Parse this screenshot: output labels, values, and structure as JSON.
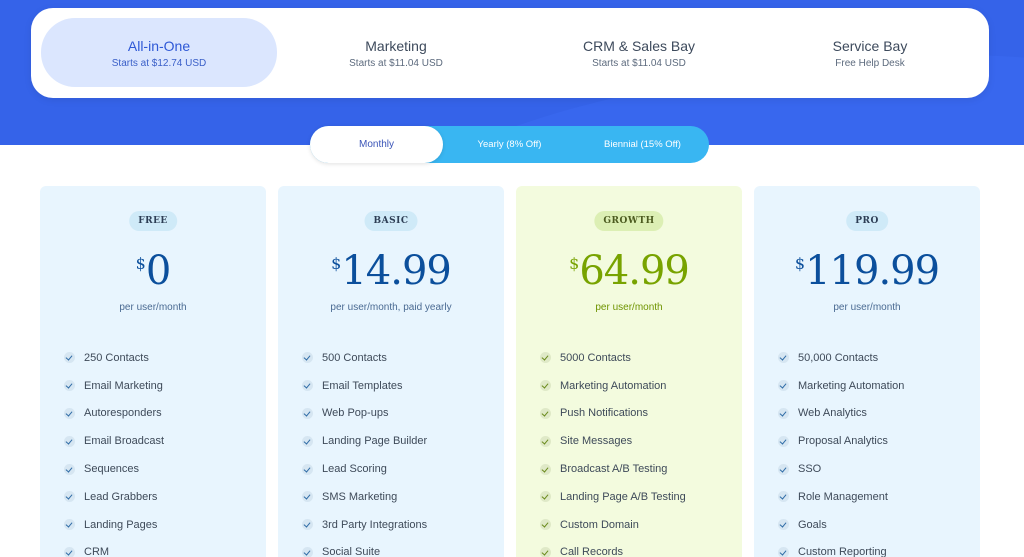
{
  "products": [
    {
      "name": "All-in-One",
      "sub": "Starts at $12.74 USD"
    },
    {
      "name": "Marketing",
      "sub": "Starts at $11.04 USD"
    },
    {
      "name": "CRM & Sales Bay",
      "sub": "Starts at $11.04 USD"
    },
    {
      "name": "Service Bay",
      "sub": "Free Help Desk"
    }
  ],
  "billing": {
    "monthly": "Monthly",
    "yearly": "Yearly (8% Off)",
    "biennial": "Biennial (15% Off)"
  },
  "plans": [
    {
      "badge": "FREE",
      "currency": "$",
      "price": "0",
      "period": "per user/month",
      "features": [
        "250 Contacts",
        "Email Marketing",
        "Autoresponders",
        "Email Broadcast",
        "Sequences",
        "Lead Grabbers",
        "Landing Pages",
        "CRM"
      ]
    },
    {
      "badge": "BASIC",
      "currency": "$",
      "price": "14.99",
      "period": "per user/month, paid yearly",
      "features": [
        "500 Contacts",
        "Email Templates",
        "Web Pop-ups",
        "Landing Page Builder",
        "Lead Scoring",
        "SMS Marketing",
        "3rd Party Integrations",
        "Social Suite"
      ]
    },
    {
      "badge": "GROWTH",
      "currency": "$",
      "price": "64.99",
      "period": "per user/month",
      "features": [
        "5000 Contacts",
        "Marketing Automation",
        "Push Notifications",
        "Site Messages",
        "Broadcast A/B Testing",
        "Landing Page A/B Testing",
        "Custom Domain",
        "Call Records"
      ]
    },
    {
      "badge": "PRO",
      "currency": "$",
      "price": "119.99",
      "period": "per user/month",
      "features": [
        "50,000 Contacts",
        "Marketing Automation",
        "Web Analytics",
        "Proposal Analytics",
        "SSO",
        "Role Management",
        "Goals",
        "Custom Reporting"
      ]
    }
  ],
  "colors": {
    "header_blue": "#3563e9",
    "toggle_blue": "#39b6f2",
    "price_blue": "#0b4f9c",
    "growth_green": "#78a300"
  }
}
